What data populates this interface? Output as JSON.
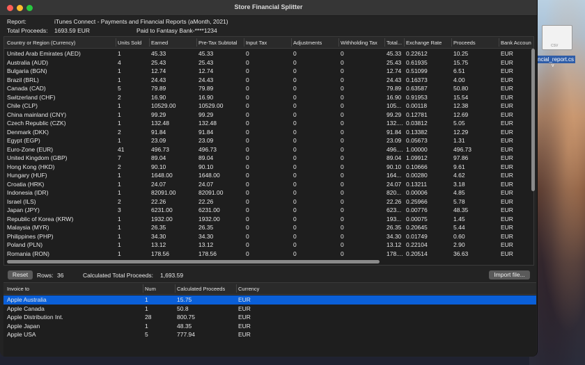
{
  "window": {
    "title": "Store Financial Splitter"
  },
  "report": {
    "report_label": "Report:",
    "report_value": "iTunes Connect - Payments and Financial Reports  (aMonth, 2021)",
    "total_label": "Total Proceeds:",
    "total_value": "1693.59 EUR",
    "paid_label": "Paid to Fantasy Bank-****1234"
  },
  "top_table": {
    "columns": [
      "Country or Region (Currency)",
      "Units Sold",
      "Earned",
      "Pre-Tax Subtotal",
      "Input Tax",
      "Adjustments",
      "Withholding Tax",
      "Total...",
      "Exchange Rate",
      "Proceeds",
      "Bank Accoun"
    ],
    "rows": [
      [
        "United Arab Emirates (AED)",
        "1",
        "45.33",
        "45.33",
        "0",
        "0",
        "0",
        "45.33",
        "0.22612",
        "10.25",
        "EUR"
      ],
      [
        "Australia (AUD)",
        "4",
        "25.43",
        "25.43",
        "0",
        "0",
        "0",
        "25.43",
        "0.61935",
        "15.75",
        "EUR"
      ],
      [
        "Bulgaria (BGN)",
        "1",
        "12.74",
        "12.74",
        "0",
        "0",
        "0",
        "12.74",
        "0.51099",
        "6.51",
        "EUR"
      ],
      [
        "Brazil (BRL)",
        "1",
        "24.43",
        "24.43",
        "0",
        "0",
        "0",
        "24.43",
        "0.16373",
        "4.00",
        "EUR"
      ],
      [
        "Canada (CAD)",
        "5",
        "79.89",
        "79.89",
        "0",
        "0",
        "0",
        "79.89",
        "0.63587",
        "50.80",
        "EUR"
      ],
      [
        "Switzerland (CHF)",
        "2",
        "16.90",
        "16.90",
        "0",
        "0",
        "0",
        "16.90",
        "0.91953",
        "15.54",
        "EUR"
      ],
      [
        "Chile (CLP)",
        "1",
        "10529.00",
        "10529.00",
        "0",
        "0",
        "0",
        "105...",
        "0.00118",
        "12.38",
        "EUR"
      ],
      [
        "China mainland (CNY)",
        "1",
        "99.29",
        "99.29",
        "0",
        "0",
        "0",
        "99.29",
        "0.12781",
        "12.69",
        "EUR"
      ],
      [
        "Czech Republic (CZK)",
        "1",
        "132.48",
        "132.48",
        "0",
        "0",
        "0",
        "132....",
        "0.03812",
        "5.05",
        "EUR"
      ],
      [
        "Denmark (DKK)",
        "2",
        "91.84",
        "91.84",
        "0",
        "0",
        "0",
        "91.84",
        "0.13382",
        "12.29",
        "EUR"
      ],
      [
        "Egypt (EGP)",
        "1",
        "23.09",
        "23.09",
        "0",
        "0",
        "0",
        "23.09",
        "0.05673",
        "1.31",
        "EUR"
      ],
      [
        "Euro-Zone (EUR)",
        "41",
        "496.73",
        "496.73",
        "0",
        "0",
        "0",
        "496....",
        "1.00000",
        "496.73",
        "EUR"
      ],
      [
        "United Kingdom (GBP)",
        "7",
        "89.04",
        "89.04",
        "0",
        "0",
        "0",
        "89.04",
        "1.09912",
        "97.86",
        "EUR"
      ],
      [
        "Hong Kong (HKD)",
        "2",
        "90.10",
        "90.10",
        "0",
        "0",
        "0",
        "90.10",
        "0.10666",
        "9.61",
        "EUR"
      ],
      [
        "Hungary (HUF)",
        "1",
        "1648.00",
        "1648.00",
        "0",
        "0",
        "0",
        "164...",
        "0.00280",
        "4.62",
        "EUR"
      ],
      [
        "Croatia (HRK)",
        "1",
        "24.07",
        "24.07",
        "0",
        "0",
        "0",
        "24.07",
        "0.13211",
        "3.18",
        "EUR"
      ],
      [
        "Indonesia (IDR)",
        "1",
        "82091.00",
        "82091.00",
        "0",
        "0",
        "0",
        "820...",
        "0.00006",
        "4.85",
        "EUR"
      ],
      [
        "Israel (ILS)",
        "2",
        "22.26",
        "22.26",
        "0",
        "0",
        "0",
        "22.26",
        "0.25966",
        "5.78",
        "EUR"
      ],
      [
        "Japan (JPY)",
        "3",
        "6231.00",
        "6231.00",
        "0",
        "0",
        "0",
        "623...",
        "0.00776",
        "48.35",
        "EUR"
      ],
      [
        "Republic of Korea (KRW)",
        "1",
        "1932.00",
        "1932.00",
        "0",
        "0",
        "0",
        "193...",
        "0.00075",
        "1.45",
        "EUR"
      ],
      [
        "Malaysia (MYR)",
        "1",
        "26.35",
        "26.35",
        "0",
        "0",
        "0",
        "26.35",
        "0.20645",
        "5.44",
        "EUR"
      ],
      [
        "Philippines (PHP)",
        "1",
        "34.30",
        "34.30",
        "0",
        "0",
        "0",
        "34.30",
        "0.01749",
        "0.60",
        "EUR"
      ],
      [
        "Poland (PLN)",
        "1",
        "13.12",
        "13.12",
        "0",
        "0",
        "0",
        "13.12",
        "0.22104",
        "2.90",
        "EUR"
      ],
      [
        "Romania (RON)",
        "1",
        "178.56",
        "178.56",
        "0",
        "0",
        "0",
        "178....",
        "0.20514",
        "36.63",
        "EUR"
      ]
    ]
  },
  "controls": {
    "reset_label": "Reset",
    "rows_label": "Rows:",
    "rows_value": "36",
    "calc_label": "Calculated Total Proceeds:",
    "calc_value": "1,693.59",
    "import_label": "Import file..."
  },
  "bottom_table": {
    "columns": [
      "Invoice to",
      "Num",
      "Calculated Proceeds",
      "Currency"
    ],
    "rows": [
      [
        "Apple Australia",
        "1",
        "15.75",
        "EUR"
      ],
      [
        "Apple Canada",
        "1",
        "50.8",
        "EUR"
      ],
      [
        "Apple Distribution Int.",
        "28",
        "800.75",
        "EUR"
      ],
      [
        "Apple Japan",
        "1",
        "48.35",
        "EUR"
      ],
      [
        "Apple USA",
        "5",
        "777.94",
        "EUR"
      ]
    ],
    "selected_index": 0
  },
  "desktop": {
    "file_name": "ncial_report.cs",
    "file_ext": "CSV"
  }
}
